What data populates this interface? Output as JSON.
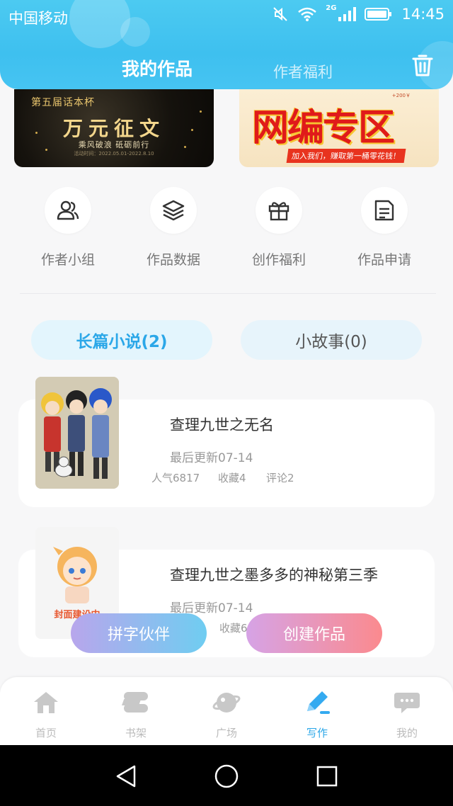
{
  "status_bar": {
    "carrier": "中国移动",
    "network": "2G",
    "time": "14:45"
  },
  "header": {
    "tabs": [
      {
        "label": "我的作品",
        "active": true
      },
      {
        "label": "作者福利",
        "active": false
      }
    ],
    "trash_icon": "trash-icon"
  },
  "banners": {
    "left": {
      "small": "第五届话本杯",
      "main": "万元征文",
      "sub": "乘风破浪 砥砺前行",
      "date": "活动时间：2022.05.01-2022.8.10"
    },
    "right": {
      "bonus": "+200￥",
      "main": "网编专区",
      "sub": "加入我们，赚取第一桶零花钱！"
    }
  },
  "actions": [
    {
      "label": "作者小组",
      "icon": "users-icon"
    },
    {
      "label": "作品数据",
      "icon": "layers-icon"
    },
    {
      "label": "创作福利",
      "icon": "gift-icon"
    },
    {
      "label": "作品申请",
      "icon": "document-icon"
    }
  ],
  "categories": [
    {
      "label": "长篇小说(2)",
      "active": true
    },
    {
      "label": "小故事(0)",
      "active": false
    }
  ],
  "works": [
    {
      "title": "查理九世之无名",
      "updated": "最后更新07-14",
      "popularity": "人气6817",
      "favorites": "收藏4",
      "comments": "评论2"
    },
    {
      "title": "查理九世之墨多多的神秘第三季",
      "updated": "最后更新07-14",
      "favorites": "收藏6",
      "cover_text": "封面建设中"
    }
  ],
  "fab": {
    "left": "拼字伙伴",
    "right": "创建作品"
  },
  "bottom_nav": [
    {
      "label": "首页",
      "icon": "home-icon",
      "active": false
    },
    {
      "label": "书架",
      "icon": "bookshelf-icon",
      "active": false
    },
    {
      "label": "广场",
      "icon": "planet-icon",
      "active": false
    },
    {
      "label": "写作",
      "icon": "pen-icon",
      "active": true
    },
    {
      "label": "我的",
      "icon": "chat-icon",
      "active": false
    }
  ],
  "colors": {
    "header_blue": "#3ec0ef",
    "accent": "#2ba7e8",
    "background": "#f7f7f8"
  }
}
